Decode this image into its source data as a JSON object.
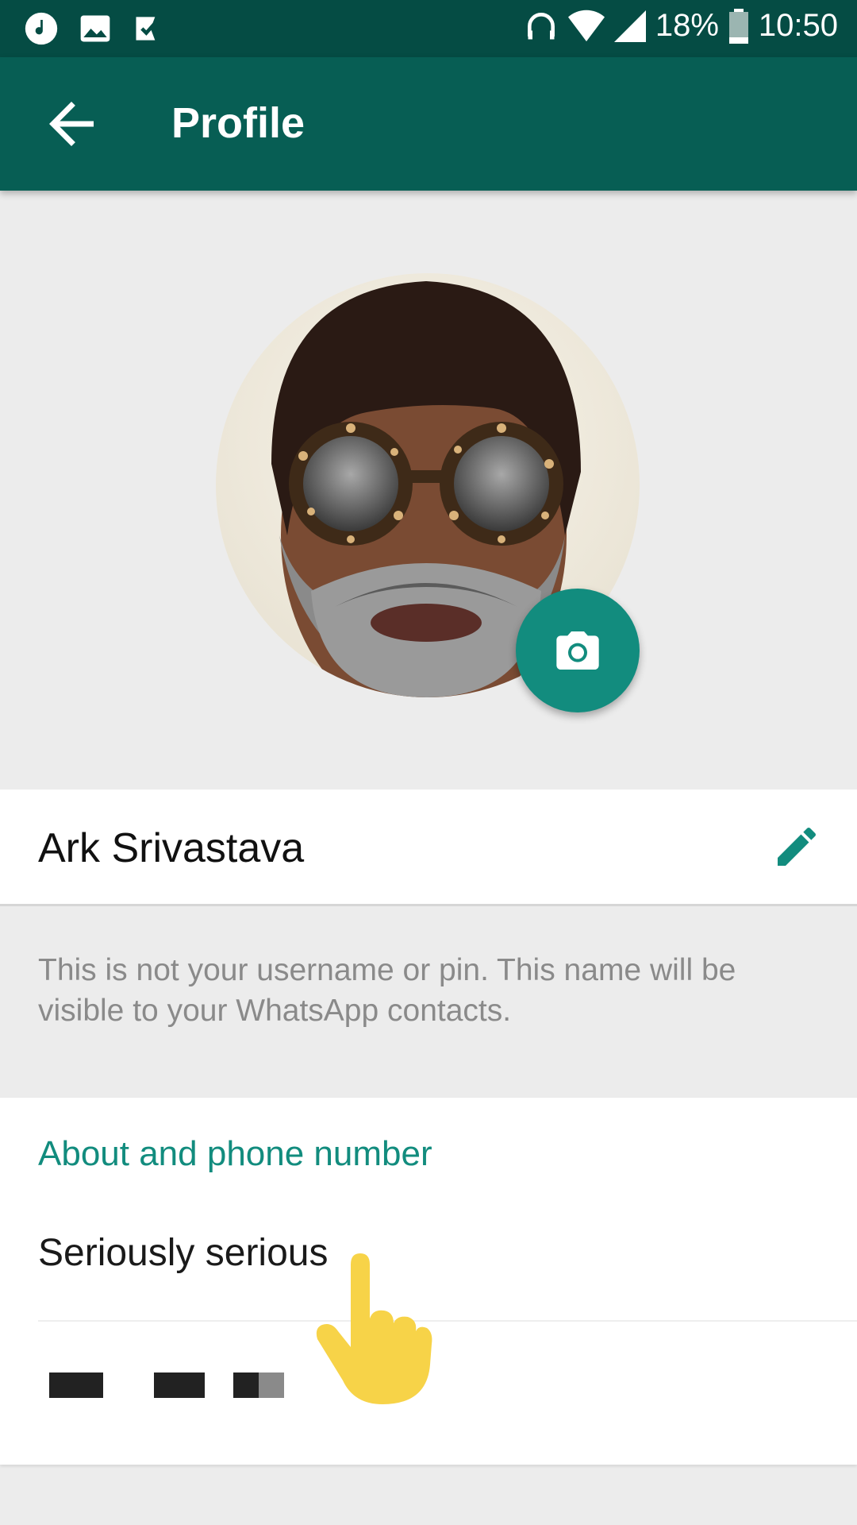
{
  "status_bar": {
    "battery": "18%",
    "time": "10:50"
  },
  "app_bar": {
    "title": "Profile"
  },
  "profile": {
    "name": "Ark Srivastava",
    "name_hint": "This is not your username or pin. This name will be visible to your WhatsApp contacts."
  },
  "about_section": {
    "header": "About and phone number",
    "about": "Seriously serious",
    "phone": ""
  },
  "colors": {
    "status_bar": "#054c44",
    "app_bar": "#075e54",
    "accent": "#128c7e"
  },
  "icons": {
    "back": "arrow-left-icon",
    "camera": "camera-icon",
    "edit": "pencil-icon"
  }
}
